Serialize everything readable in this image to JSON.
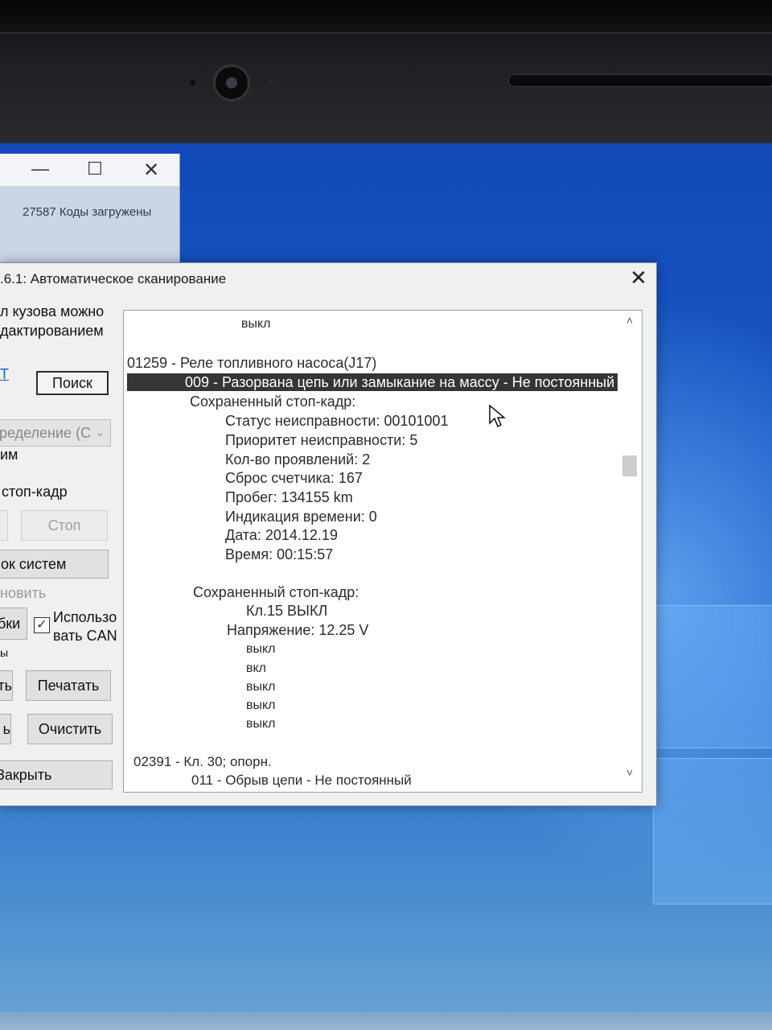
{
  "background_window": {
    "minimize": "—",
    "maximize": "☐",
    "close": "✕",
    "status": "27587 Коды загружены"
  },
  "dialog": {
    "title": ".6.1:  Автоматическое сканирование",
    "close": "✕",
    "left_panel": {
      "note_line1": "л кузова можно",
      "note_line2": "дактированием",
      "link_text": "Т",
      "search_button": "Поиск",
      "combo_value": "ределение (С",
      "label_mode": "им",
      "label_freeze": "стоп-кадр",
      "stop_button": "Стоп",
      "systems_button": "ок систем",
      "label_update": "новить",
      "errors_button": "бки",
      "use_can_line1": "Использо",
      "use_can_line2": "вать CAN",
      "use_can_checked": "✓",
      "label_small": "ы",
      "left_button_a": "ть",
      "print_button": "Печатать",
      "left_button_b": "ь",
      "clear_button": "Очистить",
      "close_button": "Закрыть"
    },
    "log": {
      "lines": [
        "выкл",
        "01259 - Реле топливного насоса(J17)",
        "009 - Разорвана цепь или замыкание на массу - Не постоянный",
        "Сохраненный стоп-кадр:",
        "Статус неисправности: 00101001",
        "Приоритет неисправности: 5",
        "Кол-во проявлений: 2",
        "Сброс счетчика: 167",
        "Пробег: 134155 km",
        "Индикация времени: 0",
        "Дата: 2014.12.19",
        "Время: 00:15:57",
        "Сохраненный стоп-кадр:",
        "Кл.15 ВЫКЛ",
        "Напряжение: 12.25 V",
        "выкл",
        "вкл",
        "выкл",
        "выкл",
        "выкл",
        "02391 - Кл. 30; опорн.",
        "011 - Обрыв цепи - Не постоянный"
      ],
      "scroll_up": "˄",
      "scroll_down": "˅"
    }
  }
}
